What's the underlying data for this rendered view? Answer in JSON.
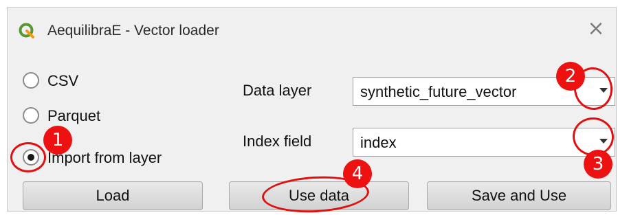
{
  "window": {
    "title": "AequilibraE - Vector loader",
    "close_glyph": "×",
    "app_icon": "qgis-icon"
  },
  "radios": [
    {
      "label": "CSV",
      "checked": false
    },
    {
      "label": "Parquet",
      "checked": false
    },
    {
      "label": "Import from layer",
      "checked": true
    }
  ],
  "fields": {
    "data_layer_label": "Data layer",
    "data_layer_value": "synthetic_future_vector",
    "index_field_label": "Index field",
    "index_field_value": "index"
  },
  "buttons": {
    "load": "Load",
    "use_data": "Use data",
    "save_and_use": "Save and Use"
  },
  "annotations": {
    "callout_1": "1",
    "callout_2": "2",
    "callout_3": "3",
    "callout_4": "4",
    "color": "#ee1111"
  }
}
